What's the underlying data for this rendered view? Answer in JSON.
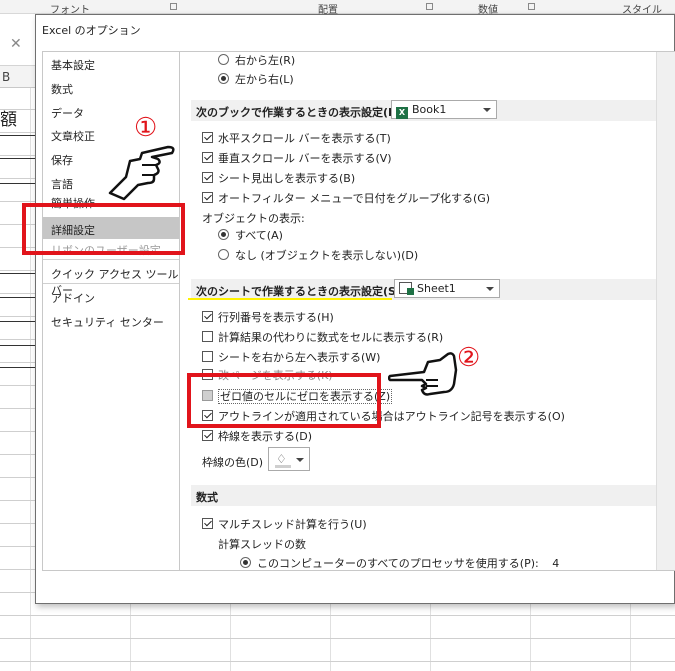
{
  "excel": {
    "ribbon_groups": [
      "フォント",
      "配置",
      "数値",
      "スタイル"
    ],
    "col_header": "B",
    "cell_text": "額"
  },
  "dialog": {
    "title": "Excel のオプション",
    "nav": [
      {
        "label": "基本設定"
      },
      {
        "label": "数式"
      },
      {
        "label": "データ"
      },
      {
        "label": "文章校正"
      },
      {
        "label": "保存"
      },
      {
        "label": "言語"
      },
      {
        "label": "簡単操作"
      },
      {
        "label": "詳細設定",
        "selected": true
      },
      {
        "label": "リボンのユーザー設定"
      },
      {
        "label": "クイック アクセス ツール バー"
      },
      {
        "label": "アドイン"
      },
      {
        "label": "セキュリティ センター"
      }
    ],
    "content": {
      "rtl": "右から左(R)",
      "ltr": "左から右(L)",
      "book_section": "次のブックで作業するときの表示設定(B):",
      "book_name": "Book1",
      "book_options": [
        {
          "label": "水平スクロール バーを表示する(T)",
          "checked": true
        },
        {
          "label": "垂直スクロール バーを表示する(V)",
          "checked": true
        },
        {
          "label": "シート見出しを表示する(B)",
          "checked": true
        },
        {
          "label": "オートフィルター メニューで日付をグループ化する(G)",
          "checked": true
        }
      ],
      "object_display_label": "オブジェクトの表示:",
      "object_all": "すべて(A)",
      "object_none": "なし (オブジェクトを表示しない)(D)",
      "sheet_section": "次のシートで作業するときの表示設定(S):",
      "sheet_name": "Sheet1",
      "sheet_options": [
        {
          "label": "行列番号を表示する(H)",
          "checked": true
        },
        {
          "label": "計算結果の代わりに数式をセルに表示する(R)",
          "checked": false
        },
        {
          "label": "シートを右から左へ表示する(W)",
          "checked": false
        },
        {
          "label": "改ページを表示する(K)",
          "checked": false
        },
        {
          "label": "ゼロ値のセルにゼロを表示する(Z)",
          "checked": false
        },
        {
          "label": "アウトラインが適用されている場合はアウトライン記号を表示する(O)",
          "checked": true
        },
        {
          "label": "枠線を表示する(D)",
          "checked": true
        }
      ],
      "gridline_color_label": "枠線の色(D)",
      "formula_section": "数式",
      "multithread": "マルチスレッド計算を行う(U)",
      "thread_count_label": "計算スレッドの数",
      "all_processors": "このコンピューターのすべてのプロセッサを使用する(P):",
      "processor_count": "4"
    }
  },
  "annotations": {
    "marker_1": "①",
    "marker_2": "②",
    "highlight_color": "#e1141b",
    "underline_color": "#fff200"
  }
}
